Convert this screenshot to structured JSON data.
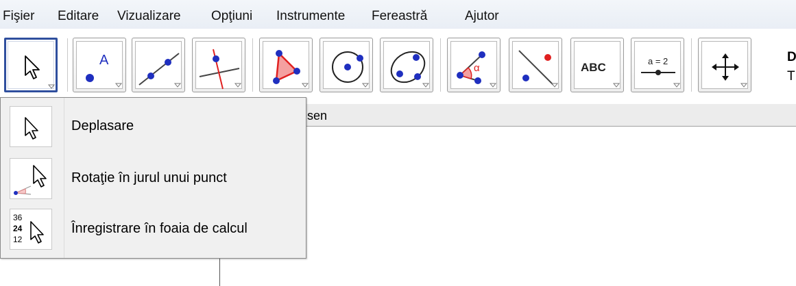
{
  "menu": [
    "Fişier",
    "Editare",
    "Vizualizare",
    "Opţiuni",
    "Instrumente",
    "Fereastră",
    "Ajutor"
  ],
  "toolbar": {
    "tools": [
      {
        "name": "move-tool",
        "icon": "arrow-cursor-icon"
      },
      {
        "name": "point-tool",
        "icon": "point-A-icon",
        "label": "A"
      },
      {
        "name": "line-tool",
        "icon": "line-through-points-icon"
      },
      {
        "name": "perpendicular-line-tool",
        "icon": "perpendicular-line-icon"
      },
      {
        "name": "polygon-tool",
        "icon": "triangle-polygon-icon"
      },
      {
        "name": "circle-tool",
        "icon": "circle-center-point-icon"
      },
      {
        "name": "conic-tool",
        "icon": "ellipse-icon"
      },
      {
        "name": "angle-tool",
        "icon": "angle-alpha-icon",
        "label": "α"
      },
      {
        "name": "reflect-tool",
        "icon": "reflect-line-icon"
      },
      {
        "name": "text-tool",
        "icon": "text-abc-icon",
        "label": "ABC"
      },
      {
        "name": "slider-tool",
        "icon": "slider-icon",
        "label": "a = 2"
      },
      {
        "name": "move-graphics-view-tool",
        "icon": "move-arrows-icon"
      }
    ],
    "help_letters": [
      "D",
      "T"
    ]
  },
  "graphics_view": {
    "title_fragment": "esen"
  },
  "dropdown": {
    "items": [
      {
        "icon": "arrow-cursor-icon",
        "label": "Deplasare"
      },
      {
        "icon": "rotate-around-point-icon",
        "label": "Rotaţie în jurul unui punct"
      },
      {
        "icon": "record-to-spreadsheet-icon",
        "label": "Înregistrare în foaia de calcul",
        "icon_numbers": [
          "36",
          "24",
          "12"
        ]
      }
    ]
  },
  "colors": {
    "point": "#1f2fbf",
    "accent": "#e02020",
    "selected_border": "#2f4f9e"
  }
}
